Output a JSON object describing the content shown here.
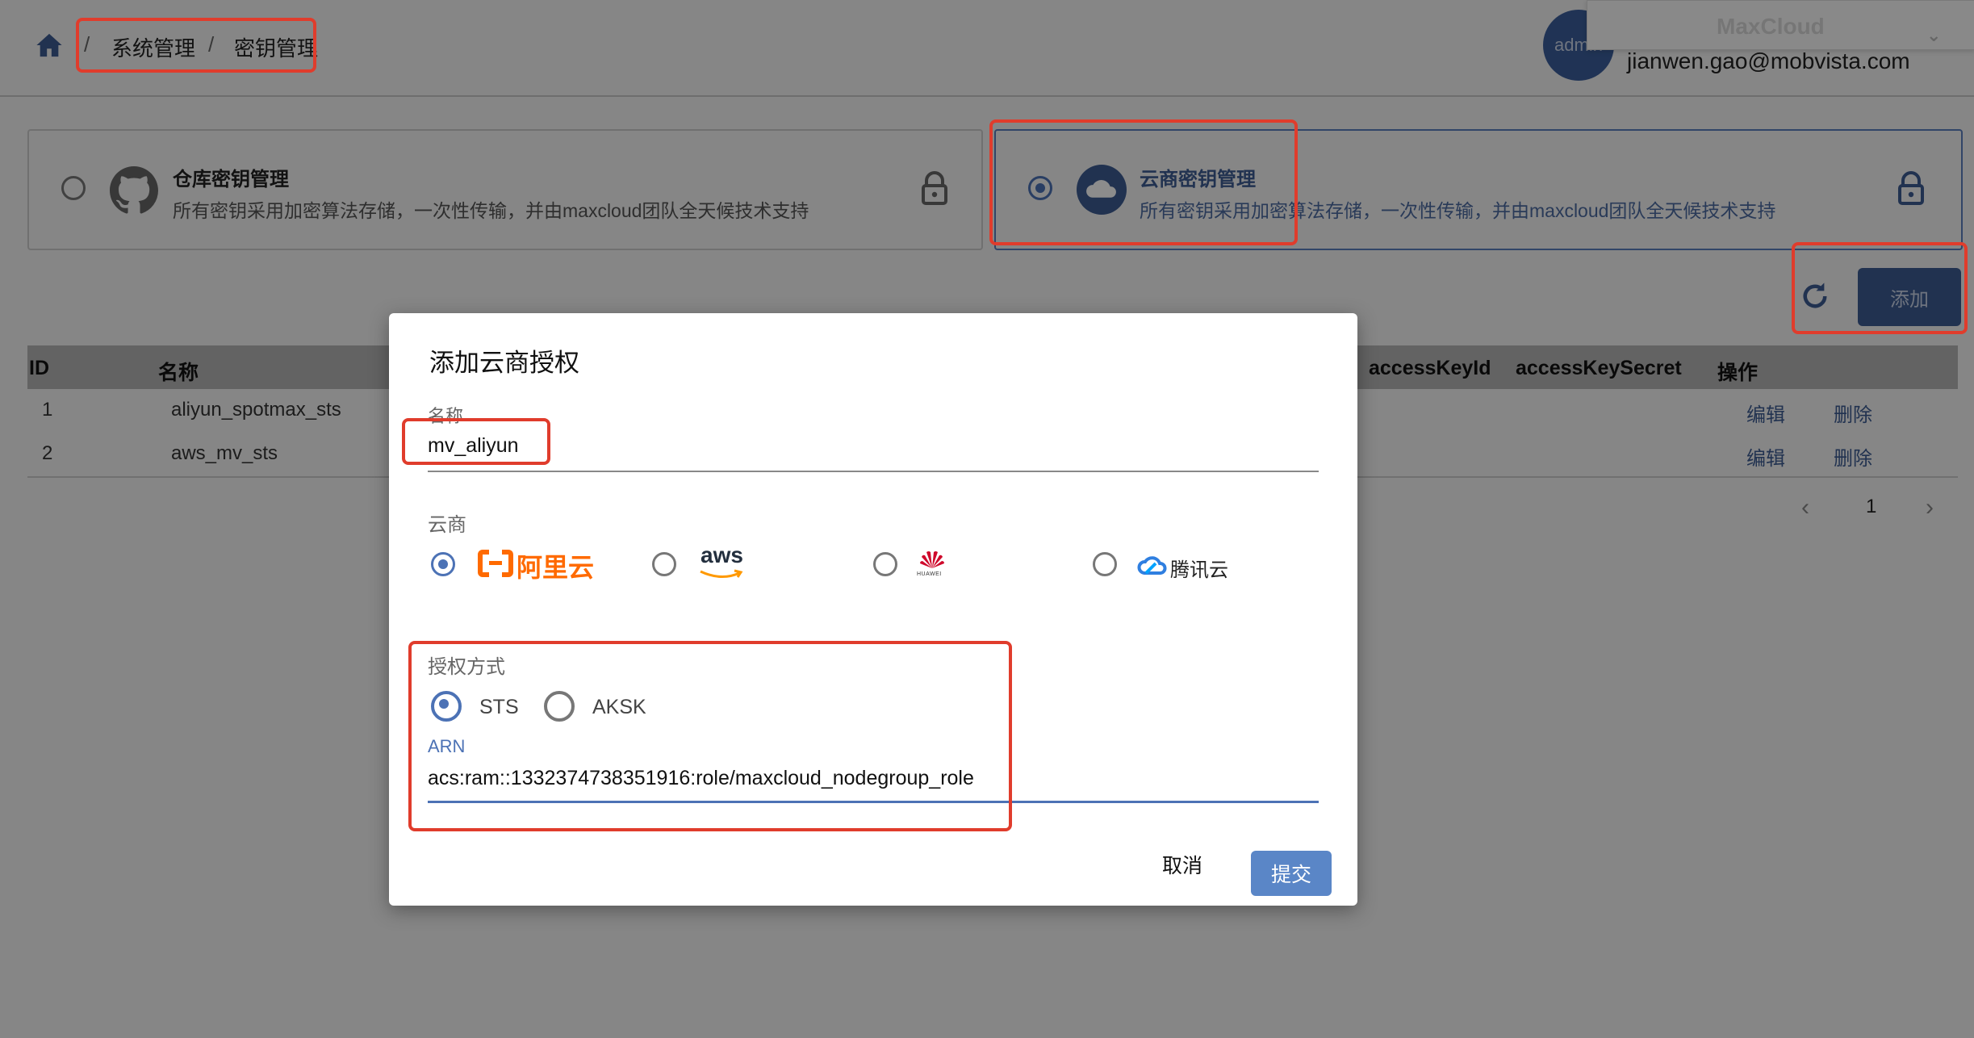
{
  "header": {
    "breadcrumb": [
      "系统管理",
      "密钥管理"
    ],
    "avatar_text": "admin",
    "user_email": "jianwen.gao@mobvista.com",
    "popup_title": "MaxCloud"
  },
  "cards": [
    {
      "title": "仓库密钥管理",
      "desc": "所有密钥采用加密算法存储，一次性传输，并由maxcloud团队全天候技术支持",
      "selected": false
    },
    {
      "title": "云商密钥管理",
      "desc": "所有密钥采用加密算法存储，一次性传输，并由maxcloud团队全天候技术支持",
      "selected": true
    }
  ],
  "toolbar": {
    "add_label": "添加"
  },
  "table": {
    "columns": [
      "ID",
      "名称",
      "accessKeyId",
      "accessKeySecret",
      "操作"
    ],
    "rows": [
      {
        "id": "1",
        "name": "aliyun_spotmax_sts",
        "edit": "编辑",
        "delete": "删除"
      },
      {
        "id": "2",
        "name": "aws_mv_sts",
        "edit": "编辑",
        "delete": "删除"
      }
    ]
  },
  "pagination": {
    "current": "1"
  },
  "modal": {
    "title": "添加云商授权",
    "name_label": "名称",
    "name_value": "mv_aliyun",
    "provider_label": "云商",
    "providers": [
      {
        "name": "阿里云",
        "selected": true
      },
      {
        "name": "aws",
        "selected": false
      },
      {
        "name": "HUAWEI",
        "selected": false
      },
      {
        "name": "腾讯云",
        "selected": false
      }
    ],
    "auth_label": "授权方式",
    "auth_options": [
      {
        "name": "STS",
        "selected": true
      },
      {
        "name": "AKSK",
        "selected": false
      }
    ],
    "arn_label": "ARN",
    "arn_value": "acs:ram::1332374738351916:role/maxcloud_nodegroup_role",
    "cancel_label": "取消",
    "submit_label": "提交"
  },
  "colors": {
    "accent": "#4c72b5",
    "submit": "#5a86c7",
    "highlight": "#e03c2c"
  }
}
